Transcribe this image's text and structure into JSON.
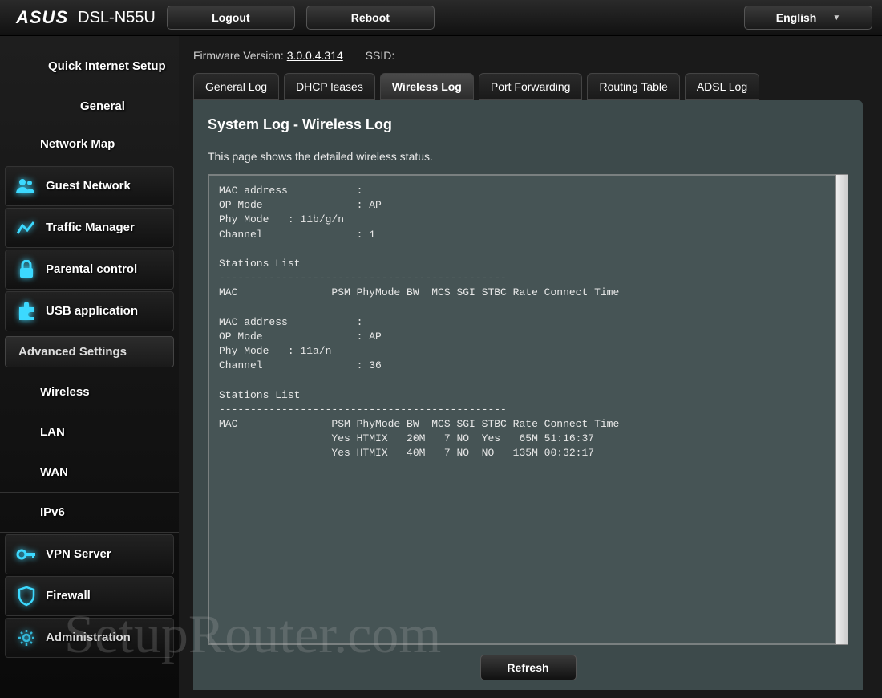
{
  "header": {
    "brand": "ASUS",
    "model": "DSL-N55U",
    "logout": "Logout",
    "reboot": "Reboot",
    "language": "English"
  },
  "sidebar": {
    "quick": "Quick Internet Setup",
    "general": "General",
    "network_map": "Network Map",
    "guest": "Guest Network",
    "traffic": "Traffic Manager",
    "parental": "Parental control",
    "usb": "USB application",
    "adv_hdr": "Advanced Settings",
    "wireless": "Wireless",
    "lan": "LAN",
    "wan": "WAN",
    "ipv6": "IPv6",
    "vpn": "VPN Server",
    "firewall": "Firewall",
    "admin": "Administration"
  },
  "firmware": {
    "label": "Firmware Version:",
    "version": "3.0.0.4.314",
    "ssid_label": "SSID:"
  },
  "tabs": {
    "general": "General Log",
    "dhcp": "DHCP leases",
    "wireless": "Wireless Log",
    "port": "Port Forwarding",
    "routing": "Routing Table",
    "adsl": "ADSL Log"
  },
  "panel": {
    "title": "System Log - Wireless Log",
    "subtitle": "This page shows the detailed wireless status.",
    "refresh": "Refresh"
  },
  "log": "MAC address           :\nOP Mode               : AP\nPhy Mode   : 11b/g/n\nChannel               : 1\n\nStations List\n----------------------------------------------\nMAC               PSM PhyMode BW  MCS SGI STBC Rate Connect Time\n\nMAC address           :\nOP Mode               : AP\nPhy Mode   : 11a/n\nChannel               : 36\n\nStations List\n----------------------------------------------\nMAC               PSM PhyMode BW  MCS SGI STBC Rate Connect Time\n                  Yes HTMIX   20M   7 NO  Yes   65M 51:16:37\n                  Yes HTMIX   40M   7 NO  NO   135M 00:32:17",
  "watermark": "SetupRouter.com"
}
